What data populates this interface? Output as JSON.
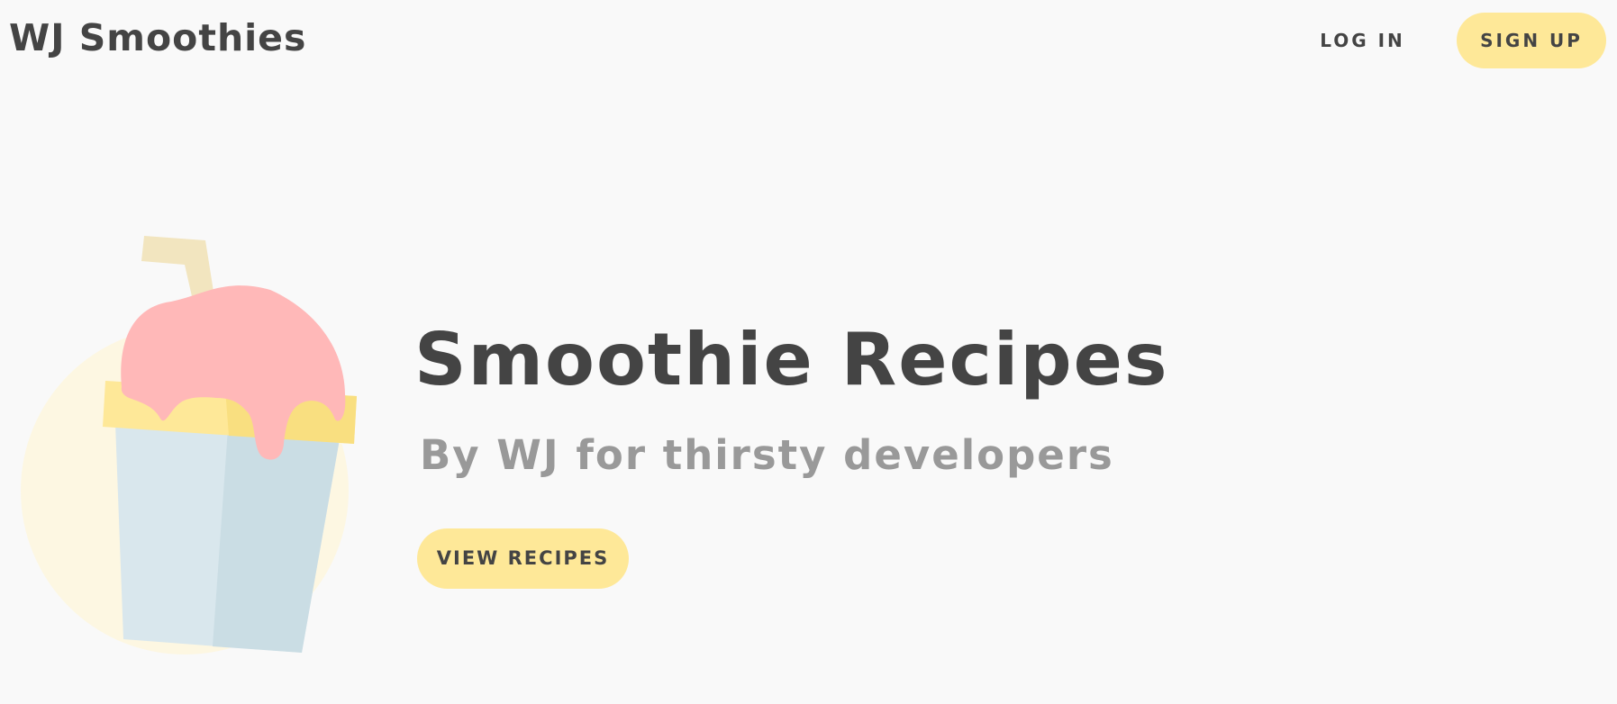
{
  "nav": {
    "brand": "WJ Smoothies",
    "login_label": "LOG IN",
    "signup_label": "SIGN UP"
  },
  "hero": {
    "title": "Smoothie Recipes",
    "subtitle": "By WJ for thirsty developers",
    "cta_label": "VIEW RECIPES",
    "illustration_icon": "smoothie-cup-icon"
  },
  "colors": {
    "background": "#f9f9f9",
    "accent_yellow": "#fee898",
    "text_dark": "#444444",
    "text_muted": "#999999",
    "smoothie_pink": "#ffb8b8",
    "cup_blue": "#d8e6ec",
    "circle_cream": "#fdf7e2"
  }
}
